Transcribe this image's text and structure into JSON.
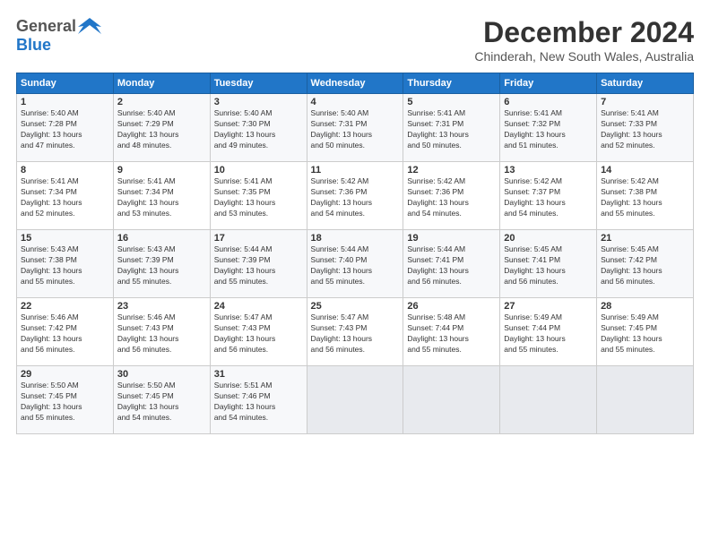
{
  "logo": {
    "general": "General",
    "blue": "Blue"
  },
  "title": {
    "month_year": "December 2024",
    "location": "Chinderah, New South Wales, Australia"
  },
  "days_of_week": [
    "Sunday",
    "Monday",
    "Tuesday",
    "Wednesday",
    "Thursday",
    "Friday",
    "Saturday"
  ],
  "weeks": [
    [
      {
        "day": "1",
        "rise": "5:40 AM",
        "set": "7:28 PM",
        "daylight": "13 hours and 47 minutes."
      },
      {
        "day": "2",
        "rise": "5:40 AM",
        "set": "7:29 PM",
        "daylight": "13 hours and 48 minutes."
      },
      {
        "day": "3",
        "rise": "5:40 AM",
        "set": "7:30 PM",
        "daylight": "13 hours and 49 minutes."
      },
      {
        "day": "4",
        "rise": "5:40 AM",
        "set": "7:31 PM",
        "daylight": "13 hours and 50 minutes."
      },
      {
        "day": "5",
        "rise": "5:41 AM",
        "set": "7:31 PM",
        "daylight": "13 hours and 50 minutes."
      },
      {
        "day": "6",
        "rise": "5:41 AM",
        "set": "7:32 PM",
        "daylight": "13 hours and 51 minutes."
      },
      {
        "day": "7",
        "rise": "5:41 AM",
        "set": "7:33 PM",
        "daylight": "13 hours and 52 minutes."
      }
    ],
    [
      {
        "day": "8",
        "rise": "5:41 AM",
        "set": "7:34 PM",
        "daylight": "13 hours and 52 minutes."
      },
      {
        "day": "9",
        "rise": "5:41 AM",
        "set": "7:34 PM",
        "daylight": "13 hours and 53 minutes."
      },
      {
        "day": "10",
        "rise": "5:41 AM",
        "set": "7:35 PM",
        "daylight": "13 hours and 53 minutes."
      },
      {
        "day": "11",
        "rise": "5:42 AM",
        "set": "7:36 PM",
        "daylight": "13 hours and 54 minutes."
      },
      {
        "day": "12",
        "rise": "5:42 AM",
        "set": "7:36 PM",
        "daylight": "13 hours and 54 minutes."
      },
      {
        "day": "13",
        "rise": "5:42 AM",
        "set": "7:37 PM",
        "daylight": "13 hours and 54 minutes."
      },
      {
        "day": "14",
        "rise": "5:42 AM",
        "set": "7:38 PM",
        "daylight": "13 hours and 55 minutes."
      }
    ],
    [
      {
        "day": "15",
        "rise": "5:43 AM",
        "set": "7:38 PM",
        "daylight": "13 hours and 55 minutes."
      },
      {
        "day": "16",
        "rise": "5:43 AM",
        "set": "7:39 PM",
        "daylight": "13 hours and 55 minutes."
      },
      {
        "day": "17",
        "rise": "5:44 AM",
        "set": "7:39 PM",
        "daylight": "13 hours and 55 minutes."
      },
      {
        "day": "18",
        "rise": "5:44 AM",
        "set": "7:40 PM",
        "daylight": "13 hours and 55 minutes."
      },
      {
        "day": "19",
        "rise": "5:44 AM",
        "set": "7:41 PM",
        "daylight": "13 hours and 56 minutes."
      },
      {
        "day": "20",
        "rise": "5:45 AM",
        "set": "7:41 PM",
        "daylight": "13 hours and 56 minutes."
      },
      {
        "day": "21",
        "rise": "5:45 AM",
        "set": "7:42 PM",
        "daylight": "13 hours and 56 minutes."
      }
    ],
    [
      {
        "day": "22",
        "rise": "5:46 AM",
        "set": "7:42 PM",
        "daylight": "13 hours and 56 minutes."
      },
      {
        "day": "23",
        "rise": "5:46 AM",
        "set": "7:43 PM",
        "daylight": "13 hours and 56 minutes."
      },
      {
        "day": "24",
        "rise": "5:47 AM",
        "set": "7:43 PM",
        "daylight": "13 hours and 56 minutes."
      },
      {
        "day": "25",
        "rise": "5:47 AM",
        "set": "7:43 PM",
        "daylight": "13 hours and 56 minutes."
      },
      {
        "day": "26",
        "rise": "5:48 AM",
        "set": "7:44 PM",
        "daylight": "13 hours and 55 minutes."
      },
      {
        "day": "27",
        "rise": "5:49 AM",
        "set": "7:44 PM",
        "daylight": "13 hours and 55 minutes."
      },
      {
        "day": "28",
        "rise": "5:49 AM",
        "set": "7:45 PM",
        "daylight": "13 hours and 55 minutes."
      }
    ],
    [
      {
        "day": "29",
        "rise": "5:50 AM",
        "set": "7:45 PM",
        "daylight": "13 hours and 55 minutes."
      },
      {
        "day": "30",
        "rise": "5:50 AM",
        "set": "7:45 PM",
        "daylight": "13 hours and 54 minutes."
      },
      {
        "day": "31",
        "rise": "5:51 AM",
        "set": "7:46 PM",
        "daylight": "13 hours and 54 minutes."
      },
      null,
      null,
      null,
      null
    ]
  ]
}
